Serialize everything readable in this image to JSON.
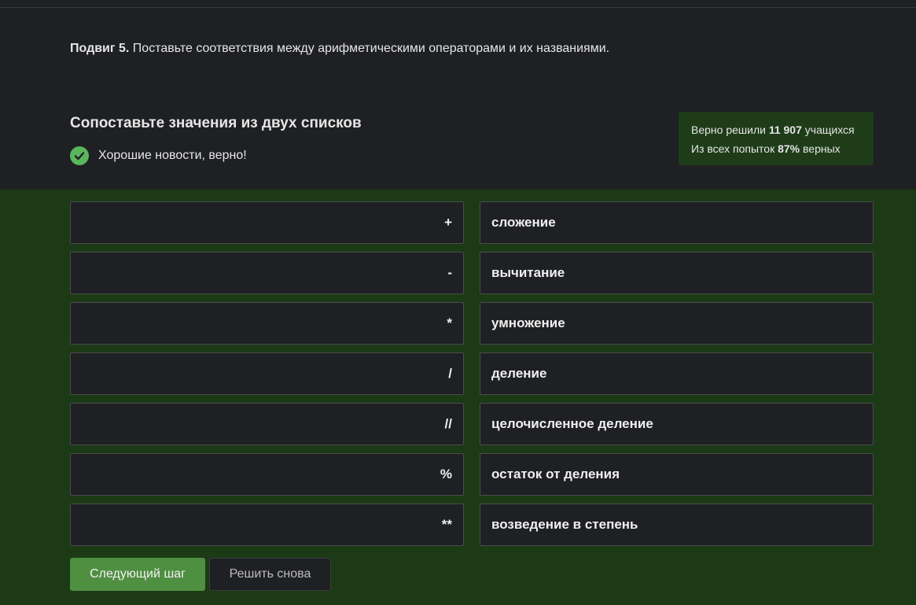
{
  "task": {
    "prefix": "Подвиг 5.",
    "text": "Поставьте соответствия между арифметическими операторами и их названиями."
  },
  "quiz": {
    "title": "Сопоставьте значения из двух списков",
    "feedback": "Хорошие новости, верно!",
    "feedback_icon": "check-circle-icon"
  },
  "stats": {
    "solved_label": "Верно решили",
    "solved_count": "11 907",
    "solved_suffix": "учащихся",
    "attempts_label": "Из всех попыток",
    "attempts_percent": "87%",
    "attempts_suffix": "верных"
  },
  "pairs": [
    {
      "operator": "+",
      "name": "сложение"
    },
    {
      "operator": "-",
      "name": "вычитание"
    },
    {
      "operator": "*",
      "name": "умножение"
    },
    {
      "operator": "/",
      "name": "деление"
    },
    {
      "operator": "//",
      "name": "целочисленное деление"
    },
    {
      "operator": "%",
      "name": "остаток от деления"
    },
    {
      "operator": "**",
      "name": "возведение в степень"
    }
  ],
  "buttons": {
    "next": "Следующий шаг",
    "retry": "Решить снова"
  },
  "colors": {
    "background": "#1f2023",
    "success_bg": "#1c3a15",
    "stats_bg": "#1e3c18",
    "check": "#59b65d",
    "primary_button": "#4f8f41"
  }
}
